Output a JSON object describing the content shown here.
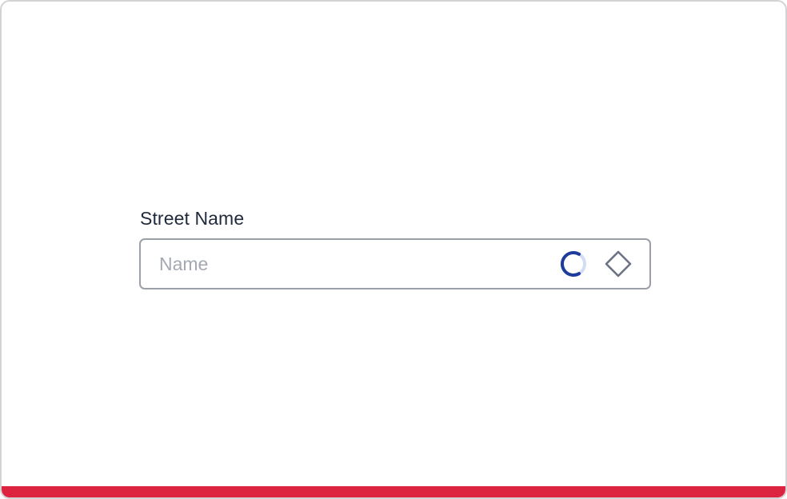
{
  "field": {
    "label": "Street Name",
    "placeholder": "Name",
    "value": ""
  },
  "icons": {
    "loading": "loading-spinner-icon",
    "trailing": "diamond-icon"
  },
  "colors": {
    "accent_bar": "#dc2340",
    "spinner_active": "#1d3c9c",
    "spinner_track": "#d4dcf3",
    "label_text": "#1f2a3c",
    "placeholder_text": "#a3a8b2",
    "input_border": "#9b9fa8",
    "icon_gray": "#6b7384"
  }
}
